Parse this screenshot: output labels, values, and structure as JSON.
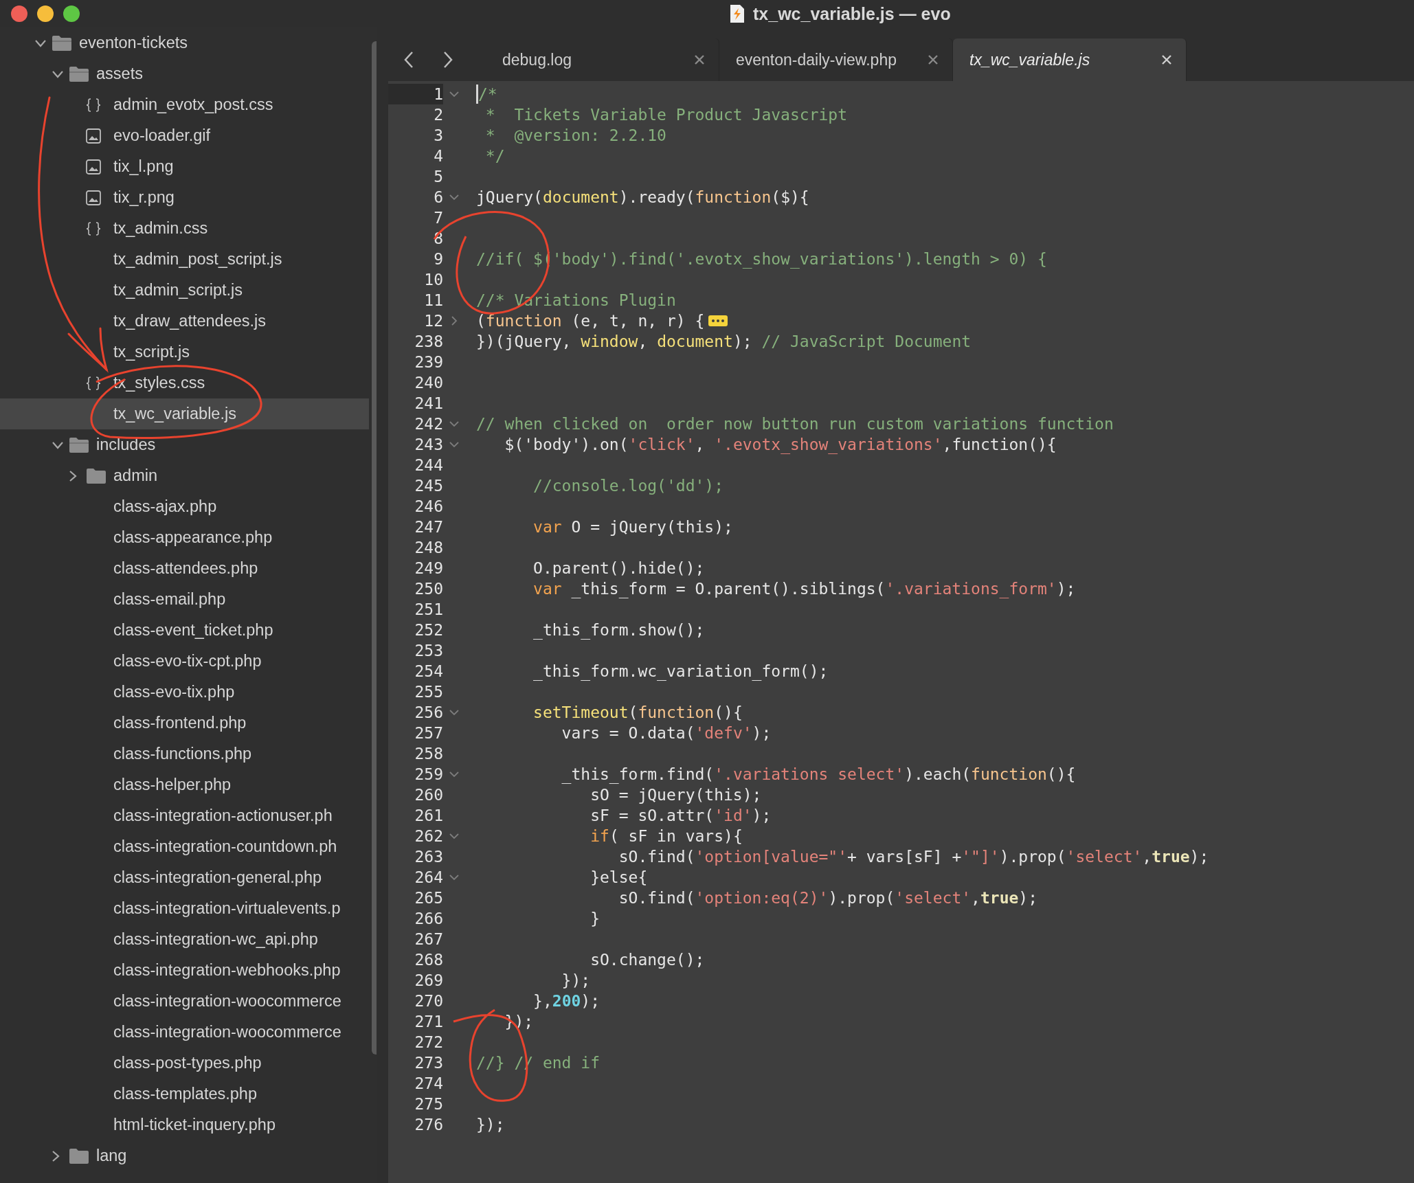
{
  "window": {
    "title": "tx_wc_variable.js — evo"
  },
  "sidebar": {
    "items": [
      {
        "label": "eventon-tickets",
        "kind": "folder",
        "expanded": true,
        "selected": false,
        "children": [
          {
            "label": "assets",
            "kind": "folder",
            "expanded": true,
            "selected": false,
            "children": [
              {
                "label": "admin_evotx_post.css",
                "kind": "stylesheet",
                "selected": false
              },
              {
                "label": "evo-loader.gif",
                "kind": "image",
                "selected": false
              },
              {
                "label": "tix_l.png",
                "kind": "image",
                "selected": false
              },
              {
                "label": "tix_r.png",
                "kind": "image",
                "selected": false
              },
              {
                "label": "tx_admin.css",
                "kind": "stylesheet",
                "selected": false
              },
              {
                "label": "tx_admin_post_script.js",
                "kind": "file",
                "selected": false
              },
              {
                "label": "tx_admin_script.js",
                "kind": "file",
                "selected": false
              },
              {
                "label": "tx_draw_attendees.js",
                "kind": "file",
                "selected": false
              },
              {
                "label": "tx_script.js",
                "kind": "file",
                "selected": false
              },
              {
                "label": "tx_styles.css",
                "kind": "stylesheet",
                "selected": false
              },
              {
                "label": "tx_wc_variable.js",
                "kind": "file",
                "selected": true
              }
            ]
          },
          {
            "label": "includes",
            "kind": "folder",
            "expanded": true,
            "selected": false,
            "children": [
              {
                "label": "admin",
                "kind": "folder",
                "expanded": false,
                "selected": false
              },
              {
                "label": "class-ajax.php",
                "kind": "file",
                "selected": false
              },
              {
                "label": "class-appearance.php",
                "kind": "file",
                "selected": false
              },
              {
                "label": "class-attendees.php",
                "kind": "file",
                "selected": false
              },
              {
                "label": "class-email.php",
                "kind": "file",
                "selected": false
              },
              {
                "label": "class-event_ticket.php",
                "kind": "file",
                "selected": false
              },
              {
                "label": "class-evo-tix-cpt.php",
                "kind": "file",
                "selected": false
              },
              {
                "label": "class-evo-tix.php",
                "kind": "file",
                "selected": false
              },
              {
                "label": "class-frontend.php",
                "kind": "file",
                "selected": false
              },
              {
                "label": "class-functions.php",
                "kind": "file",
                "selected": false
              },
              {
                "label": "class-helper.php",
                "kind": "file",
                "selected": false
              },
              {
                "label": "class-integration-actionuser.ph",
                "kind": "file",
                "selected": false
              },
              {
                "label": "class-integration-countdown.ph",
                "kind": "file",
                "selected": false
              },
              {
                "label": "class-integration-general.php",
                "kind": "file",
                "selected": false
              },
              {
                "label": "class-integration-virtualevents.p",
                "kind": "file",
                "selected": false
              },
              {
                "label": "class-integration-wc_api.php",
                "kind": "file",
                "selected": false
              },
              {
                "label": "class-integration-webhooks.php",
                "kind": "file",
                "selected": false
              },
              {
                "label": "class-integration-woocommerce",
                "kind": "file",
                "selected": false
              },
              {
                "label": "class-integration-woocommerce",
                "kind": "file",
                "selected": false
              },
              {
                "label": "class-post-types.php",
                "kind": "file",
                "selected": false
              },
              {
                "label": "class-templates.php",
                "kind": "file",
                "selected": false
              },
              {
                "label": "html-ticket-inquery.php",
                "kind": "file",
                "selected": false
              }
            ]
          },
          {
            "label": "lang",
            "kind": "folder",
            "expanded": false,
            "selected": false
          }
        ]
      }
    ]
  },
  "tabs": [
    {
      "label": "debug.log",
      "selected": false
    },
    {
      "label": "eventon-daily-view.php",
      "selected": false
    },
    {
      "label": "tx_wc_variable.js",
      "selected": true
    }
  ],
  "editor": {
    "lines": [
      {
        "number": "1",
        "expanded": true,
        "current": true,
        "tokens": [
          {
            "kind": "comment",
            "text": "/*"
          }
        ]
      },
      {
        "number": "2",
        "current": false,
        "tokens": [
          {
            "kind": "comment",
            "text": " *  Tickets Variable Product Javascript"
          }
        ]
      },
      {
        "number": "3",
        "current": false,
        "tokens": [
          {
            "kind": "comment",
            "text": " *  @version: 2.2.10"
          }
        ]
      },
      {
        "number": "4",
        "current": false,
        "tokens": [
          {
            "kind": "comment",
            "text": " */"
          }
        ]
      },
      {
        "number": "5",
        "current": false
      },
      {
        "number": "6",
        "expanded": true,
        "current": false,
        "tokens": [
          {
            "kind": "plain",
            "text": "jQuery("
          },
          {
            "kind": "support",
            "text": "document"
          },
          {
            "kind": "plain",
            "text": ").ready("
          },
          {
            "kind": "keyword",
            "text": "function"
          },
          {
            "kind": "plain",
            "text": "($){"
          }
        ]
      },
      {
        "number": "7",
        "current": false
      },
      {
        "number": "8",
        "current": false
      },
      {
        "number": "9",
        "current": false,
        "tokens": [
          {
            "kind": "comment",
            "text": "//if( $('body').find('.evotx_show_variations').length > 0) {"
          }
        ]
      },
      {
        "number": "10",
        "current": false
      },
      {
        "number": "11",
        "current": false,
        "tokens": [
          {
            "kind": "comment",
            "text": "//* Variations Plugin"
          }
        ]
      },
      {
        "number": "12",
        "expanded": false,
        "current": false,
        "tokens": [
          {
            "kind": "plain",
            "text": "("
          },
          {
            "kind": "keyword",
            "text": "function"
          },
          {
            "kind": "plain",
            "text": " (e, t, n, r) {"
          }
        ]
      },
      {
        "number": "238",
        "current": false,
        "tokens": [
          {
            "kind": "plain",
            "text": "})(jQuery, "
          },
          {
            "kind": "support",
            "text": "window"
          },
          {
            "kind": "plain",
            "text": ", "
          },
          {
            "kind": "support",
            "text": "document"
          },
          {
            "kind": "plain",
            "text": "); "
          },
          {
            "kind": "comment",
            "text": "// JavaScript Document"
          }
        ]
      },
      {
        "number": "239",
        "current": false
      },
      {
        "number": "240",
        "current": false
      },
      {
        "number": "241",
        "current": false
      },
      {
        "number": "242",
        "expanded": true,
        "current": false,
        "tokens": [
          {
            "kind": "comment",
            "text": "// when clicked on  order now button run custom variations function"
          }
        ]
      },
      {
        "number": "243",
        "expanded": true,
        "current": false,
        "tokens": [
          {
            "kind": "plain",
            "text": "   $('body').on("
          },
          {
            "kind": "string",
            "text": "'click'"
          },
          {
            "kind": "plain",
            "text": ", "
          },
          {
            "kind": "string",
            "text": "'.evotx_show_variations'"
          },
          {
            "kind": "plain",
            "text": ",function(){"
          }
        ]
      },
      {
        "number": "244",
        "current": false
      },
      {
        "number": "245",
        "current": false,
        "tokens": [
          {
            "kind": "comment",
            "text": "      //console.log('dd');"
          }
        ]
      },
      {
        "number": "246",
        "current": false
      },
      {
        "number": "247",
        "current": false,
        "tokens": [
          {
            "kind": "storage",
            "text": "      var"
          },
          {
            "kind": "plain",
            "text": " O = jQuery(this);"
          }
        ]
      },
      {
        "number": "248",
        "current": false
      },
      {
        "number": "249",
        "current": false,
        "tokens": [
          {
            "kind": "plain",
            "text": "      O.parent().hide();"
          }
        ]
      },
      {
        "number": "250",
        "current": false,
        "tokens": [
          {
            "kind": "storage",
            "text": "      var"
          },
          {
            "kind": "plain",
            "text": " _this_form = O.parent().siblings("
          },
          {
            "kind": "string",
            "text": "'.variations_form'"
          },
          {
            "kind": "plain",
            "text": ");"
          }
        ]
      },
      {
        "number": "251",
        "current": false
      },
      {
        "number": "252",
        "current": false,
        "tokens": [
          {
            "kind": "plain",
            "text": "      _this_form.show();"
          }
        ]
      },
      {
        "number": "253",
        "current": false
      },
      {
        "number": "254",
        "current": false,
        "tokens": [
          {
            "kind": "plain",
            "text": "      _this_form.wc_variation_form();"
          }
        ]
      },
      {
        "number": "255",
        "current": false
      },
      {
        "number": "256",
        "expanded": true,
        "current": false,
        "tokens": [
          {
            "kind": "support",
            "text": "      setTimeout"
          },
          {
            "kind": "plain",
            "text": "("
          },
          {
            "kind": "keyword",
            "text": "function"
          },
          {
            "kind": "plain",
            "text": "(){"
          }
        ]
      },
      {
        "number": "257",
        "current": false,
        "tokens": [
          {
            "kind": "plain",
            "text": "         vars = O.data("
          },
          {
            "kind": "string",
            "text": "'defv'"
          },
          {
            "kind": "plain",
            "text": ");"
          }
        ]
      },
      {
        "number": "258",
        "current": false
      },
      {
        "number": "259",
        "expanded": true,
        "current": false,
        "tokens": [
          {
            "kind": "plain",
            "text": "         _this_form.find("
          },
          {
            "kind": "string",
            "text": "'.variations select'"
          },
          {
            "kind": "plain",
            "text": ").each("
          },
          {
            "kind": "keyword",
            "text": "function"
          },
          {
            "kind": "plain",
            "text": "(){"
          }
        ]
      },
      {
        "number": "260",
        "current": false,
        "tokens": [
          {
            "kind": "plain",
            "text": "            sO = jQuery(this);"
          }
        ]
      },
      {
        "number": "261",
        "current": false,
        "tokens": [
          {
            "kind": "plain",
            "text": "            sF = sO.attr("
          },
          {
            "kind": "string",
            "text": "'id'"
          },
          {
            "kind": "plain",
            "text": ");"
          }
        ]
      },
      {
        "number": "262",
        "expanded": true,
        "current": false,
        "tokens": [
          {
            "kind": "storage",
            "text": "            if"
          },
          {
            "kind": "plain",
            "text": "( sF in vars){"
          }
        ]
      },
      {
        "number": "263",
        "current": false,
        "tokens": [
          {
            "kind": "plain",
            "text": "               sO.find("
          },
          {
            "kind": "string",
            "text": "'option[value=\"'"
          },
          {
            "kind": "plain",
            "text": "+ vars[sF] +"
          },
          {
            "kind": "string",
            "text": "'\"]'"
          },
          {
            "kind": "plain",
            "text": ").prop("
          },
          {
            "kind": "string",
            "text": "'select'"
          },
          {
            "kind": "plain",
            "text": ","
          },
          {
            "kind": "constant",
            "text": "true"
          },
          {
            "kind": "plain",
            "text": ");"
          }
        ]
      },
      {
        "number": "264",
        "expanded": true,
        "current": false,
        "tokens": [
          {
            "kind": "plain",
            "text": "            }else{"
          }
        ]
      },
      {
        "number": "265",
        "current": false,
        "tokens": [
          {
            "kind": "plain",
            "text": "               sO.find("
          },
          {
            "kind": "string",
            "text": "'option:eq(2)'"
          },
          {
            "kind": "plain",
            "text": ").prop("
          },
          {
            "kind": "string",
            "text": "'select'"
          },
          {
            "kind": "plain",
            "text": ","
          },
          {
            "kind": "constant",
            "text": "true"
          },
          {
            "kind": "plain",
            "text": ");"
          }
        ]
      },
      {
        "number": "266",
        "current": false,
        "tokens": [
          {
            "kind": "plain",
            "text": "            }"
          }
        ]
      },
      {
        "number": "267",
        "current": false
      },
      {
        "number": "268",
        "current": false,
        "tokens": [
          {
            "kind": "plain",
            "text": "            sO.change();"
          }
        ]
      },
      {
        "number": "269",
        "current": false,
        "tokens": [
          {
            "kind": "plain",
            "text": "         });"
          }
        ]
      },
      {
        "number": "270",
        "current": false,
        "tokens": [
          {
            "kind": "plain",
            "text": "      },"
          },
          {
            "kind": "number",
            "text": "200"
          },
          {
            "kind": "plain",
            "text": ");"
          }
        ]
      },
      {
        "number": "271",
        "current": false,
        "tokens": [
          {
            "kind": "plain",
            "text": "   });"
          }
        ]
      },
      {
        "number": "272",
        "current": false
      },
      {
        "number": "273",
        "current": false,
        "tokens": [
          {
            "kind": "comment",
            "text": "//} // end if"
          }
        ]
      },
      {
        "number": "274",
        "current": false
      },
      {
        "number": "275",
        "current": false
      },
      {
        "number": "276",
        "current": false,
        "tokens": [
          {
            "kind": "plain",
            "text": "});"
          }
        ]
      }
    ]
  }
}
